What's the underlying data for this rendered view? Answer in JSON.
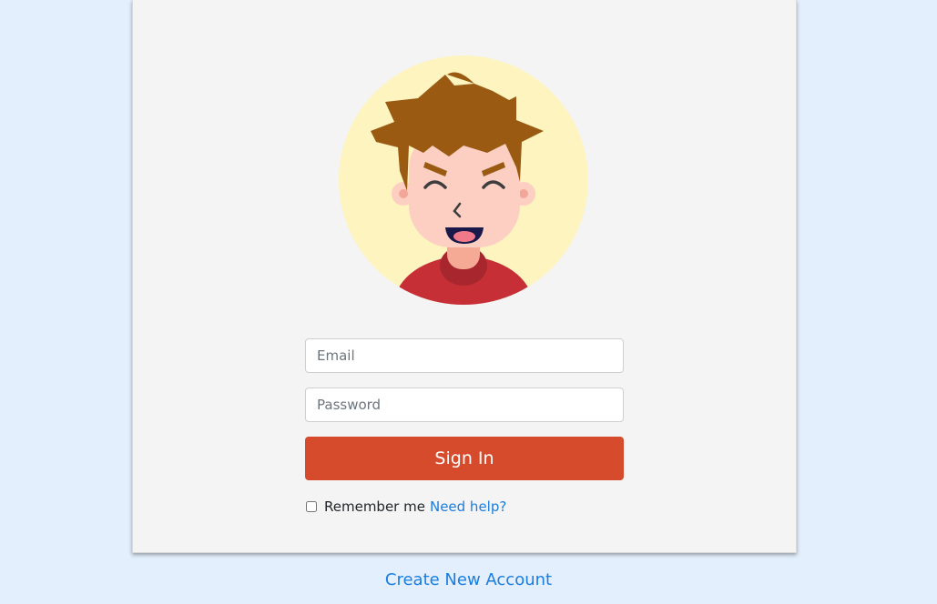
{
  "login": {
    "email_placeholder": "Email",
    "email_value": "",
    "password_placeholder": "Password",
    "password_value": "",
    "signin_label": "Sign In",
    "remember_label": "Remember me",
    "remember_checked": false,
    "help_link": "Need help?"
  },
  "footer": {
    "create_account_link": "Create New Account"
  },
  "colors": {
    "page_background": "#e3effd",
    "card_background": "#f4f4f4",
    "signin_button": "#d64b2c",
    "link": "#1a7de0",
    "avatar_background": "#fef4c0"
  },
  "icons": {
    "avatar": "cartoon-boy-avatar-icon"
  }
}
